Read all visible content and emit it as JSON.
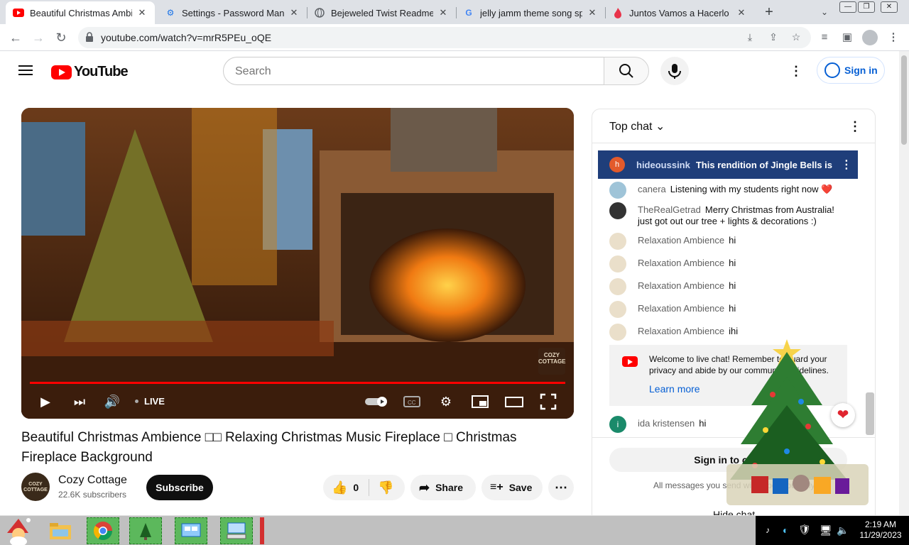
{
  "browser": {
    "tabs": [
      {
        "title": "Beautiful Christmas Ambien",
        "icon": "youtube-icon",
        "active": true
      },
      {
        "title": "Settings - Password Manag",
        "icon": "gear-icon",
        "active": false
      },
      {
        "title": "Bejeweled Twist Readme",
        "icon": "globe-icon",
        "active": false
      },
      {
        "title": "jelly jamm theme song spa",
        "icon": "google-icon",
        "active": false
      },
      {
        "title": "Juntos Vamos a Hacerlo | V",
        "icon": "flame-icon",
        "active": false
      }
    ],
    "url": "youtube.com/watch?v=mrR5PEu_oQE"
  },
  "youtube": {
    "logo_text": "YouTube",
    "search_placeholder": "Search",
    "sign_in": "Sign in"
  },
  "video": {
    "live_label": "LIVE",
    "watermark": "COZY COTTAGE",
    "title": "Beautiful Christmas Ambience □□ Relaxing Christmas Music Fireplace □ Christmas Fireplace Background",
    "channel": {
      "name": "Cozy Cottage",
      "subscribers": "22.6K subscribers",
      "avatar_text": "COZY COTTAGE"
    },
    "subscribe_label": "Subscribe",
    "likes": "0",
    "share_label": "Share",
    "save_label": "Save"
  },
  "chat": {
    "header": "Top chat",
    "pinned": {
      "avatar": "h",
      "author": "hideoussink",
      "message": "This rendition of Jingle Bells is ..."
    },
    "messages": [
      {
        "author": "canera",
        "text": "Listening with my students right now ❤️"
      },
      {
        "author": "TheRealGetrad",
        "text": "Merry Christmas from Australia! just got out our tree + lights & decorations :)"
      },
      {
        "author": "Relaxation Ambience",
        "text": "hi"
      },
      {
        "author": "Relaxation Ambience",
        "text": "hi"
      },
      {
        "author": "Relaxation Ambience",
        "text": "hi"
      },
      {
        "author": "Relaxation Ambience",
        "text": "hi"
      },
      {
        "author": "Relaxation Ambience",
        "text": "ihi"
      },
      {
        "author": "ida kristensen",
        "text": "hi",
        "avatar": "i"
      }
    ],
    "welcome": {
      "text": "Welcome to live chat! Remember to guard your privacy and abide by our community guidelines.",
      "link": "Learn more"
    },
    "sign_in": "Sign in to chat",
    "footer_note": "All messages you send will appear publicly",
    "hide_chat": "Hide chat"
  },
  "taskbar": {
    "time": "2:19 AM",
    "date": "11/29/2023"
  },
  "colors": {
    "youtube_red": "#ff0000",
    "pinned_bg": "#1f3e7a",
    "link_blue": "#065fd4",
    "taskbar_app": "#5cb85c"
  }
}
